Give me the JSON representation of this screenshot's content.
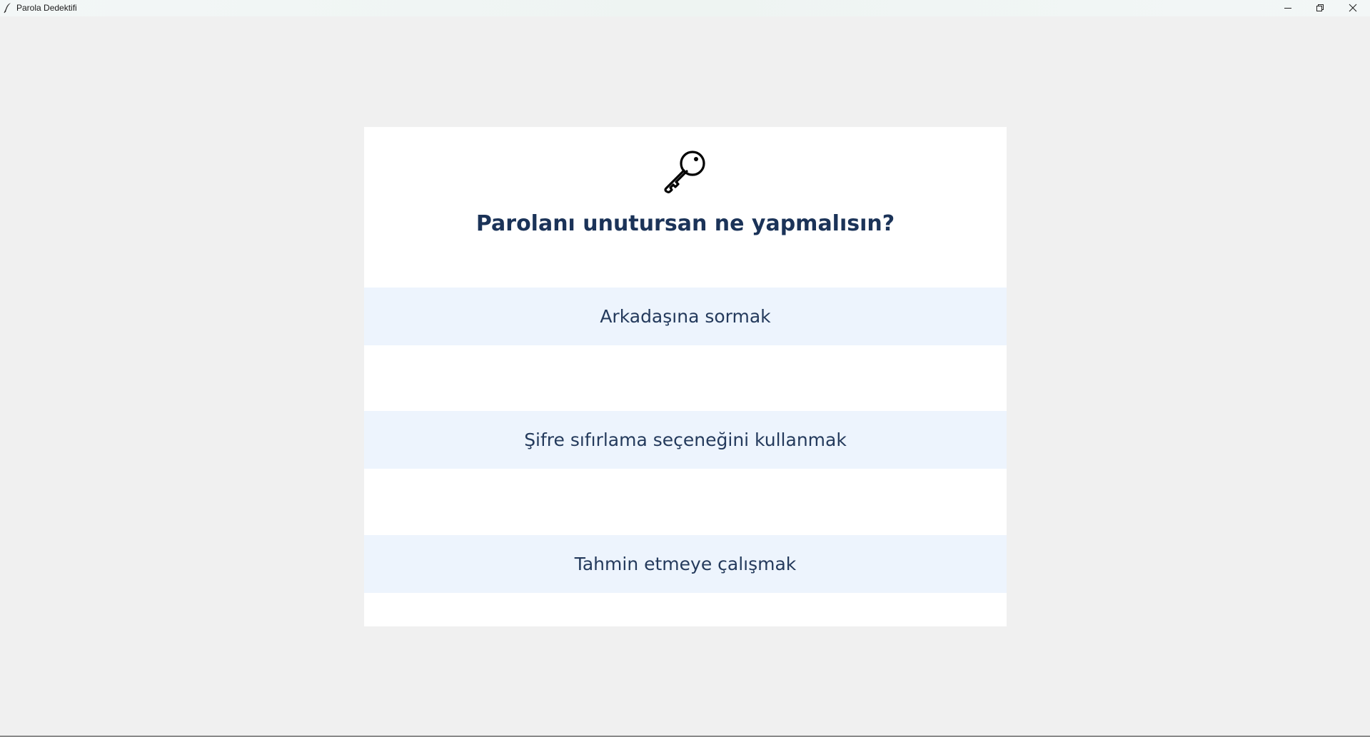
{
  "window": {
    "title": "Parola Dedektifi",
    "icons": {
      "app": "feather-icon",
      "minimize": "minimize-icon",
      "maximize": "restore-icon",
      "close": "close-icon"
    }
  },
  "quiz": {
    "icon": "key-icon",
    "question": "Parolanı unutursan ne yapmalısın?",
    "options": [
      {
        "label": "Arkadaşına sormak"
      },
      {
        "label": "Şifre sıfırlama seçeneğini kullanmak"
      },
      {
        "label": "Tahmin etmeye çalışmak"
      }
    ]
  },
  "colors": {
    "background": "#f0f0f0",
    "card": "#ffffff",
    "option_background": "#edf4fd",
    "question_text": "#1b3358",
    "option_text": "#243a5c"
  }
}
